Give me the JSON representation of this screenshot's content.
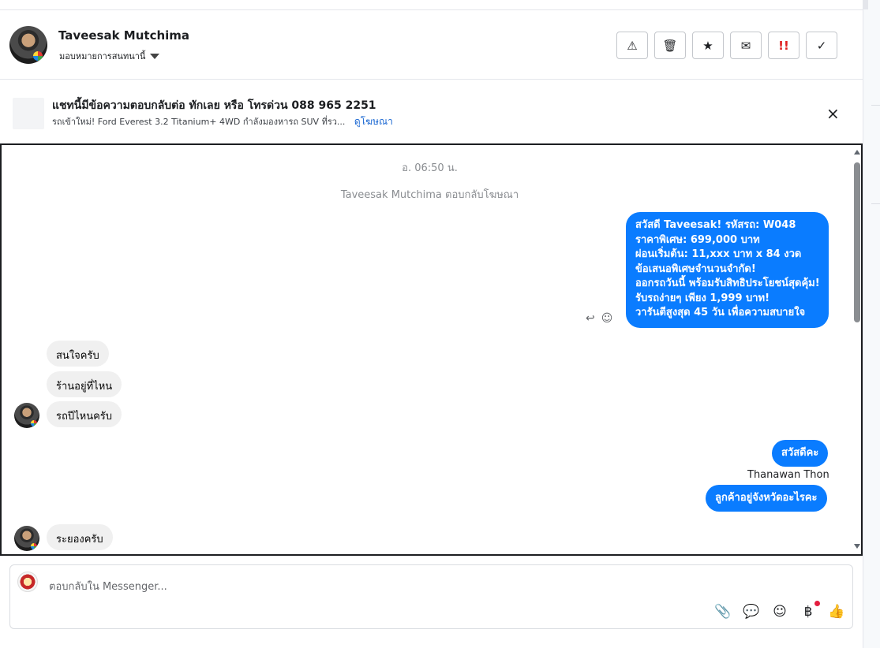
{
  "header": {
    "name": "Taveesak Mutchima",
    "assign_label": "มอบหมายการสนทนานี้",
    "actions": [
      {
        "icon": "warning-icon",
        "glyph": "⚠"
      },
      {
        "icon": "trash-icon",
        "glyph": "🗑"
      },
      {
        "icon": "star-icon",
        "glyph": "★"
      },
      {
        "icon": "mail-icon",
        "glyph": "✉"
      },
      {
        "icon": "priority-icon",
        "glyph": "!!"
      },
      {
        "icon": "check-icon",
        "glyph": "✓"
      }
    ]
  },
  "ad": {
    "title": "แชทนี้มีข้อความตอบกลับต่อ ทักเลย หรือ โทรด่วน 088 965 2251",
    "subtitle": "รถเข้าใหม่! Ford Everest 3.2 Titanium+ 4WD กำลังมองหารถ SUV ที่รว...",
    "link": "ดูโฆษณา",
    "close_glyph": "×"
  },
  "chat": {
    "timestamp": "อ. 06:50 น.",
    "system_note": "Taveesak Mutchima ตอบกลับโฆษณา",
    "outgoing_ad_lines": [
      "สวัสดี Taveesak! รหัสรถ: W048",
      "ราคาพิเศษ: 699,000 บาท",
      "ผ่อนเริ่มต้น: 11,xxx บาท x 84 งวด",
      "ข้อเสนอพิเศษจำนวนจำกัด!",
      "ออกรถวันนี้ พร้อมรับสิทธิประโยชน์สุดคุ้ม!",
      "รับรถง่ายๆ เพียง 1,999 บาท!",
      "วารันตีสูงสุด 45 วัน เพื่อความสบายใจ"
    ],
    "reply_icon": "↩",
    "emoji_icon": "☺",
    "incoming_1": "สนใจครับ",
    "incoming_2": "ร้านอยู่ที่ไหน",
    "incoming_3": "รถปีไหนครับ",
    "outgoing_hello": "สวัสดีคะ",
    "sender_name": "Thanawan Thon",
    "outgoing_province": "ลูกค้าอยู่จังหวัดอะไรคะ",
    "incoming_4": "ระยองครับ"
  },
  "composer": {
    "placeholder": "ตอบกลับใน Messenger...",
    "tools": [
      {
        "icon": "paperclip-icon",
        "glyph": "📎"
      },
      {
        "icon": "saved-reply-icon",
        "glyph": "💬"
      },
      {
        "icon": "emoji-icon",
        "glyph": "☺"
      },
      {
        "icon": "baht-icon",
        "glyph": "฿"
      },
      {
        "icon": "thumbs-up-icon",
        "glyph": "👍"
      }
    ]
  },
  "colors": {
    "accent": "#0a7cff",
    "priority_red": "#e02020",
    "link": "#1a67d2"
  }
}
